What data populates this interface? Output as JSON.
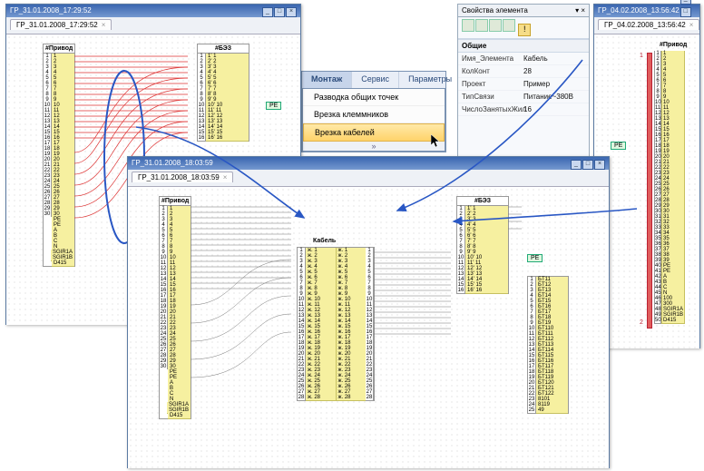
{
  "windows": {
    "topLeft": {
      "title": "ГР_31.01.2008_17:29:52",
      "tab": "ГР_31.01.2008_17:29:52",
      "groups": {
        "left": "#Привод",
        "right": "#БЭЗ"
      }
    },
    "bottom": {
      "title": "ГР_31.01.2008_18:03:59",
      "tab": "ГР_31.01.2008_18:03:59",
      "groups": {
        "left": "#Привод",
        "mid": "Кабель",
        "right": "#БЭЗ"
      }
    },
    "right": {
      "title": "ГР_04.02.2008_13:56:42",
      "tab": "ГР_04.02.2008_13:56:42",
      "group": "#Привод"
    }
  },
  "ribbon": {
    "tabs": [
      "Монтаж",
      "Сервис",
      "Параметры"
    ],
    "selected": 0,
    "menu": [
      "Разводка общих точек",
      "Врезка клеммников",
      "Врезка кабелей"
    ],
    "highlighted": 2
  },
  "palette": {
    "title": "Свойства элемента",
    "section": "Общие",
    "rows": [
      {
        "k": "Имя_Элемента",
        "v": "Кабель"
      },
      {
        "k": "КолКонт",
        "v": "28"
      },
      {
        "k": "Проект",
        "v": "Пример"
      },
      {
        "k": "ТипСвязи",
        "v": "Питание~380В"
      },
      {
        "k": "ЧислоЗанятыхЖил",
        "v": "16"
      }
    ]
  },
  "blocks": {
    "topLeft_left": {
      "pinsFrom": 1,
      "pinsTo": 30,
      "extra": [
        "PE",
        "PE",
        "A",
        "B",
        "C",
        "N",
        "SGIR1A",
        "SGIR1B",
        "D415"
      ],
      "label": "#Привод"
    },
    "topLeft_right": {
      "pinsFrom": 1,
      "pinsTo": 16,
      "wide": true,
      "label": "#БЭЗ",
      "pe": "PE"
    },
    "bottom_left": {
      "pinsFrom": 1,
      "pinsTo": 30,
      "extra": [
        "PE",
        "PE",
        "A",
        "B",
        "C",
        "N",
        "SGIR1A",
        "SGIR1B",
        "D415"
      ],
      "label": "#Привод"
    },
    "bottom_mid": {
      "label": "Кабель",
      "rows": 28,
      "cell": "ж."
    },
    "bottom_rightA": {
      "pinsFrom": 1,
      "pinsTo": 16,
      "wide": true,
      "label": "#БЭЗ",
      "pe": "PE"
    },
    "bottom_rightB": {
      "codes": [
        "БT11",
        "БT12",
        "БT13",
        "БT14",
        "БT15",
        "БT16",
        "БT17",
        "БT18",
        "БT19",
        "БT110",
        "БT111",
        "БT112",
        "БT113",
        "БT114",
        "БT115",
        "БT116",
        "БT117",
        "БT118",
        "БT119",
        "БT120",
        "БT121",
        "БT122",
        "8101",
        "8119",
        "49"
      ]
    },
    "right_strip": {
      "pinsFrom": 1,
      "pinsTo": 39,
      "extra": [
        "PE",
        "PE",
        "A",
        "B",
        "C",
        "N",
        "100",
        "300",
        "SGIR1A",
        "SGIR1B",
        "D415"
      ],
      "label": "#Привод",
      "pe": "PE",
      "busPins": [
        "1",
        "2"
      ],
      "codes": [
        "1",
        "3",
        "5",
        "7",
        "11",
        "8",
        "13",
        "4922",
        "14316",
        "14518",
        "14720",
        "14921",
        "14025",
        "14226",
        "14427",
        "14628",
        "14829",
        "15030",
        "23732",
        "23733",
        "24134",
        "35",
        "36",
        "37",
        "24538",
        "24739"
      ]
    }
  },
  "aux": {
    "chev": "»",
    "pe": "PE",
    "x": "×",
    "bang": "!"
  }
}
